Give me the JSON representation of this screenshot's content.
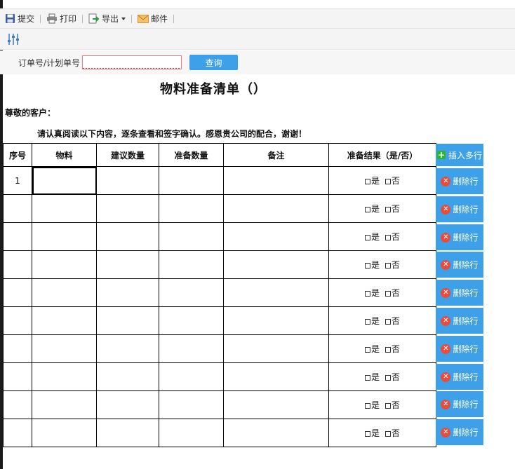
{
  "toolbar": {
    "submit_label": "提交",
    "print_label": "打印",
    "export_label": "导出",
    "mail_label": "邮件"
  },
  "search": {
    "label": "订单号/计划单号",
    "value": "",
    "button_label": "查询"
  },
  "document": {
    "title": "物料准备清单（）",
    "greeting": "尊敬的客户：",
    "instruction": "请认真阅读以下内容，逐条查看和签字确认。感恩贵公司的配合，谢谢！"
  },
  "table": {
    "headers": [
      "序号",
      "物料",
      "建议数量",
      "准备数量",
      "备注",
      "准备结果（是/否）"
    ],
    "yes_label": "是",
    "no_label": "否",
    "rows": [
      {
        "seq": "1"
      },
      {
        "seq": ""
      },
      {
        "seq": ""
      },
      {
        "seq": ""
      },
      {
        "seq": ""
      },
      {
        "seq": ""
      },
      {
        "seq": ""
      },
      {
        "seq": ""
      },
      {
        "seq": ""
      },
      {
        "seq": ""
      }
    ]
  },
  "actions": {
    "insert_rows_label": "插入多行",
    "delete_row_label": "删除行"
  },
  "colors": {
    "accent": "#3ea0e8",
    "delete_icon": "#e74c3c",
    "insert_icon": "#2db52d"
  }
}
